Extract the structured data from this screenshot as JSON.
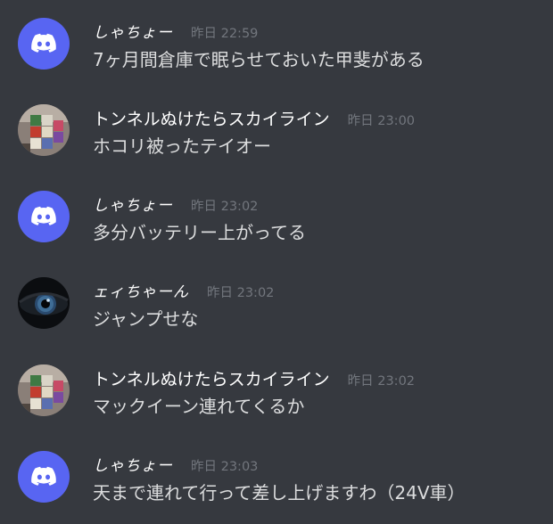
{
  "messages": [
    {
      "author": "しゃちょー",
      "time": "昨日 22:59",
      "text": "7ヶ月間倉庫で眠らせておいた甲斐がある",
      "avatar": "discord-logo-icon"
    },
    {
      "author": "トンネルぬけたらスカイライン",
      "time": "昨日 23:00",
      "text": "ホコリ被ったテイオー",
      "avatar": "cube-photo-avatar"
    },
    {
      "author": "しゃちょー",
      "time": "昨日 23:02",
      "text": "多分バッテリー上がってる",
      "avatar": "discord-logo-icon"
    },
    {
      "author": "ェィちゃーん",
      "time": "昨日 23:02",
      "text": "ジャンプせな",
      "avatar": "eye-photo-avatar"
    },
    {
      "author": "トンネルぬけたらスカイライン",
      "time": "昨日 23:02",
      "text": "マックイーン連れてくるか",
      "avatar": "cube-photo-avatar"
    },
    {
      "author": "しゃちょー",
      "time": "昨日 23:03",
      "text": "天まで連れて行って差し上げますわ（24V車）",
      "avatar": "discord-logo-icon"
    }
  ],
  "colors": {
    "background": "#36393f",
    "discord_blurple": "#5865f2",
    "username": "#ffffff",
    "timestamp": "#72767d",
    "message_text": "#dcddde"
  }
}
